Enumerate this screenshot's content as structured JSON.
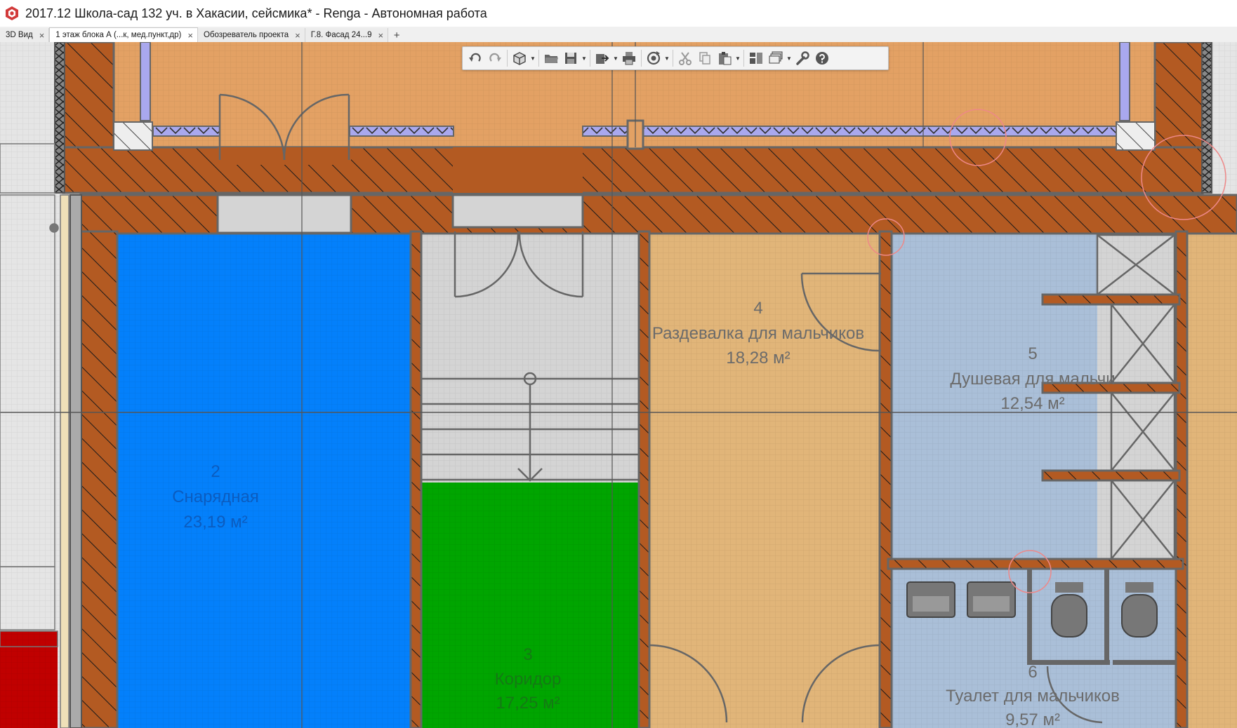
{
  "window": {
    "title": "2017.12 Школа-сад 132 уч. в Хакасии, сейсмика* - Renga - Автономная работа",
    "app_icon": "renga-logo-icon"
  },
  "tabs": [
    {
      "label": "3D Вид",
      "active": false
    },
    {
      "label": "1 этаж блока А (...к, мед.пункт,др)",
      "active": true
    },
    {
      "label": "Обозреватель проекта",
      "active": false
    },
    {
      "label": "Г.8. Фасад 24...9",
      "active": false
    }
  ],
  "tab_add_label": "+",
  "tab_close_glyph": "×",
  "toolbar": {
    "buttons": [
      "undo-icon",
      "redo-icon",
      "3d-view-icon",
      "open-folder-icon",
      "save-icon",
      "export-icon",
      "print-icon",
      "sync-icon",
      "cut-icon",
      "copy-icon",
      "paste-icon",
      "properties-icon",
      "layers-icon",
      "settings-wrench-icon",
      "help-icon"
    ],
    "dropdown_glyph": "▼"
  },
  "colors": {
    "wall_brown": "#b35a22",
    "wall_hatch": "#1a1a1a",
    "outline_gray": "#666666",
    "room_orange": "#e3a164",
    "room_tan": "#e1b579",
    "room_blue": "#0480fb",
    "room_green": "#00a500",
    "room_lightblue": "#aabfd8",
    "room_gray": "#d4d4d4",
    "room_red": "#c00000",
    "window_lavender": "#a9a8ee",
    "marker_circle": "#ee8888",
    "label_gray": "#6b6b6b"
  },
  "rooms": [
    {
      "number": "2",
      "name": "Снарядная",
      "area": "23,19 м²"
    },
    {
      "number": "3",
      "name": "Коридор",
      "area": "17,25 м²"
    },
    {
      "number": "4",
      "name": "Раздевалка для мальчиков",
      "area": "18,28 м²"
    },
    {
      "number": "5",
      "name": "Душевая для мальчи",
      "area": "12,54 м²"
    },
    {
      "number": "6",
      "name": "Туалет для мальчиков",
      "area": "9,57 м²"
    }
  ]
}
